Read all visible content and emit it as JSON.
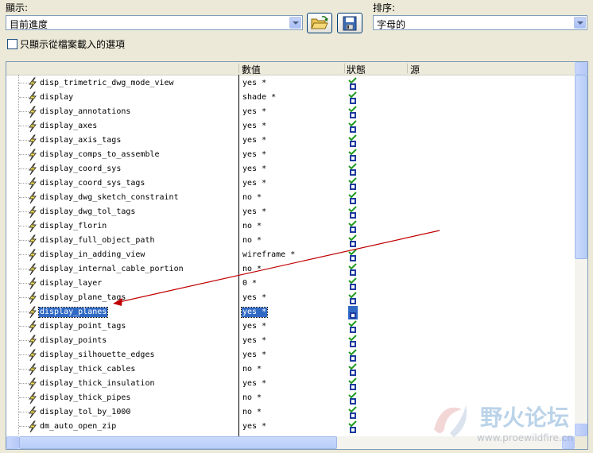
{
  "toolbar": {
    "show_label": "顯示:",
    "show_value": "目前進度",
    "sort_label": "排序:",
    "sort_value": "字母的",
    "checkbox_label": "只顯示從檔案載入的選項",
    "checkbox_checked": false
  },
  "table": {
    "columns": [
      "",
      "數值",
      "狀態",
      "源"
    ],
    "rows": [
      {
        "name": "disp_trimetric_dwg_mode_view",
        "value": "yes *",
        "status": "applied"
      },
      {
        "name": "display",
        "value": "shade *",
        "status": "applied"
      },
      {
        "name": "display_annotations",
        "value": "yes *",
        "status": "applied"
      },
      {
        "name": "display_axes",
        "value": "yes *",
        "status": "applied"
      },
      {
        "name": "display_axis_tags",
        "value": "yes *",
        "status": "applied"
      },
      {
        "name": "display_comps_to_assemble",
        "value": "yes *",
        "status": "applied"
      },
      {
        "name": "display_coord_sys",
        "value": "yes *",
        "status": "applied"
      },
      {
        "name": "display_coord_sys_tags",
        "value": "yes *",
        "status": "applied"
      },
      {
        "name": "display_dwg_sketch_constraint",
        "value": "no *",
        "status": "applied"
      },
      {
        "name": "display_dwg_tol_tags",
        "value": "yes *",
        "status": "applied"
      },
      {
        "name": "display_florin",
        "value": "no *",
        "status": "applied"
      },
      {
        "name": "display_full_object_path",
        "value": "no *",
        "status": "applied"
      },
      {
        "name": "display_in_adding_view",
        "value": "wireframe *",
        "status": "applied"
      },
      {
        "name": "display_internal_cable_portion",
        "value": "no *",
        "status": "applied"
      },
      {
        "name": "display_layer",
        "value": "0 *",
        "status": "applied"
      },
      {
        "name": "display_plane_tags",
        "value": "yes *",
        "status": "applied"
      },
      {
        "name": "display_planes",
        "value": "yes *",
        "status": "applied",
        "selected": true
      },
      {
        "name": "display_point_tags",
        "value": "yes *",
        "status": "applied"
      },
      {
        "name": "display_points",
        "value": "yes *",
        "status": "applied"
      },
      {
        "name": "display_silhouette_edges",
        "value": "yes *",
        "status": "applied"
      },
      {
        "name": "display_thick_cables",
        "value": "no *",
        "status": "applied"
      },
      {
        "name": "display_thick_insulation",
        "value": "yes *",
        "status": "applied"
      },
      {
        "name": "display_thick_pipes",
        "value": "no *",
        "status": "applied"
      },
      {
        "name": "display_tol_by_1000",
        "value": "no *",
        "status": "applied"
      },
      {
        "name": "dm_auto_open_zip",
        "value": "yes *",
        "status": "applied"
      }
    ]
  },
  "watermark": {
    "text": "野火论坛",
    "url": "www.proewildfire.cn"
  },
  "colors": {
    "selection": "#316ac5",
    "annotation_arrow": "#c00000",
    "check_green": "#1f9a1f",
    "status_blue": "#1e3a9e"
  }
}
